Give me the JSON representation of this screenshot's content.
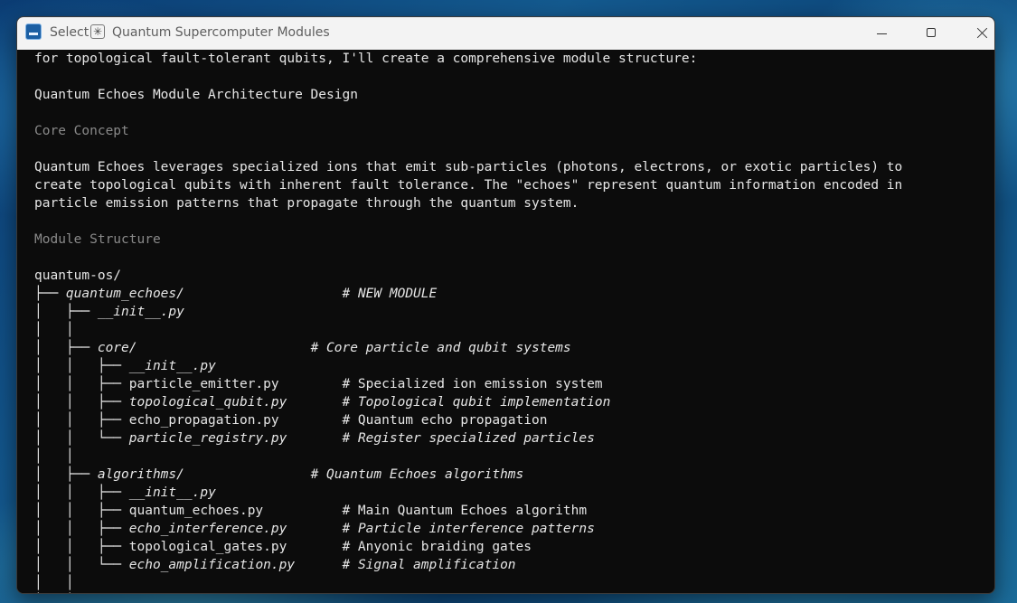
{
  "window": {
    "title_prefix": "Select",
    "title": "Quantum Supercomputer Modules",
    "spark_glyph": "✳"
  },
  "icons": [
    "terminal-app-icon",
    "spark-icon",
    "minimize-icon",
    "maximize-icon",
    "close-icon"
  ],
  "terminal": {
    "lines": [
      {
        "segments": [
          {
            "t": "for topological fault-tolerant qubits, I'll create a comprehensive module structure:"
          }
        ]
      },
      {
        "segments": [
          {
            "t": ""
          }
        ]
      },
      {
        "segments": [
          {
            "t": "Quantum Echoes Module Architecture Design"
          }
        ]
      },
      {
        "segments": [
          {
            "t": ""
          }
        ]
      },
      {
        "segments": [
          {
            "t": "Core Concept",
            "c": "dim"
          }
        ]
      },
      {
        "segments": [
          {
            "t": ""
          }
        ]
      },
      {
        "segments": [
          {
            "t": "Quantum Echoes leverages specialized ions that emit sub-particles (photons, electrons, or exotic particles) to"
          }
        ]
      },
      {
        "segments": [
          {
            "t": "create topological qubits with inherent fault tolerance. The \"echoes\" represent quantum information encoded in"
          }
        ]
      },
      {
        "segments": [
          {
            "t": "particle emission patterns that propagate through the quantum system."
          }
        ]
      },
      {
        "segments": [
          {
            "t": ""
          }
        ]
      },
      {
        "segments": [
          {
            "t": "Module Structure",
            "c": "dim"
          }
        ]
      },
      {
        "segments": [
          {
            "t": ""
          }
        ]
      },
      {
        "segments": [
          {
            "t": "quantum-os/"
          }
        ]
      },
      {
        "segments": [
          {
            "t": "├── "
          },
          {
            "t": "quantum_echoes/",
            "c": "it"
          },
          {
            "t": "                    "
          },
          {
            "t": "# NEW MODULE",
            "c": "it"
          }
        ]
      },
      {
        "segments": [
          {
            "t": "│   ├── "
          },
          {
            "t": "__init__.py",
            "c": "it"
          }
        ]
      },
      {
        "segments": [
          {
            "t": "│   │"
          }
        ]
      },
      {
        "segments": [
          {
            "t": "│   ├── "
          },
          {
            "t": "core/",
            "c": "it"
          },
          {
            "t": "                      "
          },
          {
            "t": "# Core particle and qubit systems",
            "c": "it"
          }
        ]
      },
      {
        "segments": [
          {
            "t": "│   │   ├── "
          },
          {
            "t": "__init__.py",
            "c": "it"
          }
        ]
      },
      {
        "segments": [
          {
            "t": "│   │   ├── particle_emitter.py        # Specialized ion emission system"
          }
        ]
      },
      {
        "segments": [
          {
            "t": "│   │   ├── "
          },
          {
            "t": "topological_qubit.py",
            "c": "it"
          },
          {
            "t": "       "
          },
          {
            "t": "# Topological qubit implementation",
            "c": "it"
          }
        ]
      },
      {
        "segments": [
          {
            "t": "│   │   ├── echo_propagation.py        # Quantum echo propagation"
          }
        ]
      },
      {
        "segments": [
          {
            "t": "│   │   └── "
          },
          {
            "t": "particle_registry.py",
            "c": "it"
          },
          {
            "t": "       "
          },
          {
            "t": "# Register specialized particles",
            "c": "it"
          }
        ]
      },
      {
        "segments": [
          {
            "t": "│   │"
          }
        ]
      },
      {
        "segments": [
          {
            "t": "│   ├── "
          },
          {
            "t": "algorithms/",
            "c": "it"
          },
          {
            "t": "                "
          },
          {
            "t": "# Quantum Echoes algorithms",
            "c": "it"
          }
        ]
      },
      {
        "segments": [
          {
            "t": "│   │   ├── "
          },
          {
            "t": "__init__.py",
            "c": "it"
          }
        ]
      },
      {
        "segments": [
          {
            "t": "│   │   ├── quantum_echoes.py          # Main Quantum Echoes algorithm"
          }
        ]
      },
      {
        "segments": [
          {
            "t": "│   │   ├── "
          },
          {
            "t": "echo_interference.py",
            "c": "it"
          },
          {
            "t": "       "
          },
          {
            "t": "# Particle interference patterns",
            "c": "it"
          }
        ]
      },
      {
        "segments": [
          {
            "t": "│   │   ├── topological_gates.py       # Anyonic braiding gates"
          }
        ]
      },
      {
        "segments": [
          {
            "t": "│   │   └── "
          },
          {
            "t": "echo_amplification.py",
            "c": "it"
          },
          {
            "t": "      "
          },
          {
            "t": "# Signal amplification",
            "c": "it"
          }
        ]
      },
      {
        "segments": [
          {
            "t": "│   │"
          }
        ]
      },
      {
        "segments": [
          {
            "t": "│   │"
          }
        ]
      }
    ]
  }
}
